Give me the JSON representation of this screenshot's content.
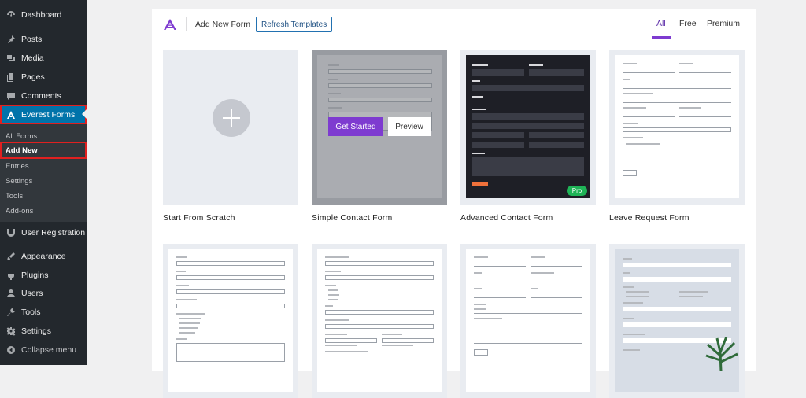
{
  "sidebar": {
    "items": [
      {
        "label": "Dashboard",
        "icon": "dashboard-icon"
      },
      {
        "label": "Posts",
        "icon": "pin-icon"
      },
      {
        "label": "Media",
        "icon": "media-icon"
      },
      {
        "label": "Pages",
        "icon": "pages-icon"
      },
      {
        "label": "Comments",
        "icon": "comment-icon"
      },
      {
        "label": "Everest Forms",
        "icon": "everest-forms-icon"
      },
      {
        "label": "User Registration",
        "icon": "user-registration-icon"
      },
      {
        "label": "Appearance",
        "icon": "brush-icon"
      },
      {
        "label": "Plugins",
        "icon": "plugin-icon"
      },
      {
        "label": "Users",
        "icon": "users-icon"
      },
      {
        "label": "Tools",
        "icon": "wrench-icon"
      },
      {
        "label": "Settings",
        "icon": "settings-icon"
      },
      {
        "label": "Collapse menu",
        "icon": "collapse-icon"
      }
    ],
    "submenu": [
      "All Forms",
      "Add New",
      "Entries",
      "Settings",
      "Tools",
      "Add-ons"
    ]
  },
  "header": {
    "title": "Add New Form",
    "refresh_label": "Refresh Templates",
    "tabs": [
      "All",
      "Free",
      "Premium"
    ]
  },
  "templates": [
    {
      "label": "Start From Scratch"
    },
    {
      "label": "Simple Contact Form",
      "get_started": "Get Started",
      "preview": "Preview"
    },
    {
      "label": "Advanced Contact Form",
      "badge": "Pro"
    },
    {
      "label": "Leave Request Form"
    }
  ],
  "colors": {
    "accent": "#7e3bd0",
    "wp_blue": "#0073aa",
    "highlight": "#e02020"
  }
}
